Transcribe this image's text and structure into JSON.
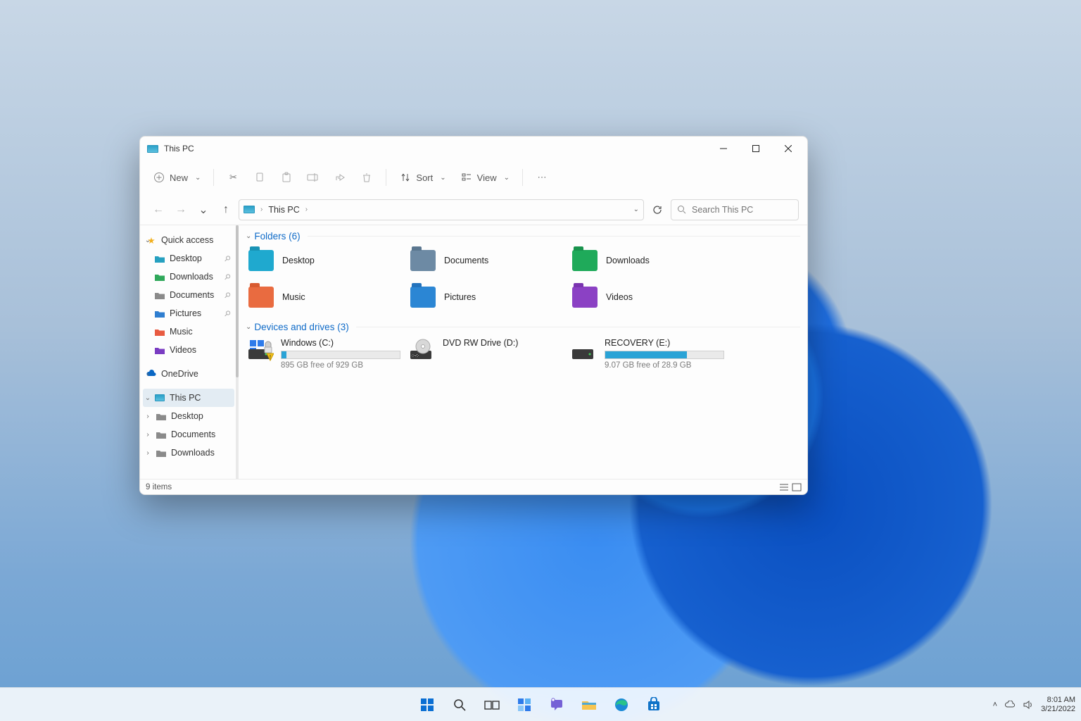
{
  "window": {
    "title": "This PC",
    "toolbar": {
      "new": "New",
      "sort": "Sort",
      "view": "View"
    },
    "address": {
      "location": "This PC"
    },
    "search": {
      "placeholder": "Search This PC"
    }
  },
  "sidebar": {
    "quick_access_label": "Quick access",
    "quick_access": [
      {
        "label": "Desktop",
        "pinned": true,
        "color": "#26a0c0"
      },
      {
        "label": "Downloads",
        "pinned": true,
        "color": "#2fa85a"
      },
      {
        "label": "Documents",
        "pinned": true,
        "color": "#8a8a8a"
      },
      {
        "label": "Pictures",
        "pinned": true,
        "color": "#2f7ed0"
      },
      {
        "label": "Music",
        "pinned": false,
        "color": "#e85b41"
      },
      {
        "label": "Videos",
        "pinned": false,
        "color": "#7a3cc2"
      }
    ],
    "onedrive_label": "OneDrive",
    "this_pc_label": "This PC",
    "this_pc_children": [
      {
        "label": "Desktop"
      },
      {
        "label": "Documents"
      },
      {
        "label": "Downloads"
      }
    ]
  },
  "content": {
    "folders_header": "Folders (6)",
    "drives_header": "Devices and drives (3)",
    "folders": [
      {
        "label": "Desktop",
        "fill": "#1fa9cf",
        "tab": "#1993b5"
      },
      {
        "label": "Documents",
        "fill": "#6d8aa4",
        "tab": "#5b7790"
      },
      {
        "label": "Downloads",
        "fill": "#1faa5a",
        "tab": "#19934d"
      },
      {
        "label": "Music",
        "fill": "#e96b40",
        "tab": "#d85a30"
      },
      {
        "label": "Pictures",
        "fill": "#2b86d4",
        "tab": "#2373bd"
      },
      {
        "label": "Videos",
        "fill": "#8b41c4",
        "tab": "#7a34b0"
      }
    ],
    "drives": [
      {
        "label": "Windows (C:)",
        "subtext": "895 GB free of 929 GB",
        "fill_pct": 4,
        "type": "hdd",
        "warn": true
      },
      {
        "label": "DVD RW Drive (D:)",
        "subtext": "",
        "fill_pct": null,
        "type": "dvd"
      },
      {
        "label": "RECOVERY (E:)",
        "subtext": "9.07 GB free of 28.9 GB",
        "fill_pct": 69,
        "type": "hdd"
      }
    ]
  },
  "statusbar": {
    "items": "9 items"
  },
  "taskbar": {
    "time": "8:01 AM",
    "date": "3/21/2022"
  }
}
